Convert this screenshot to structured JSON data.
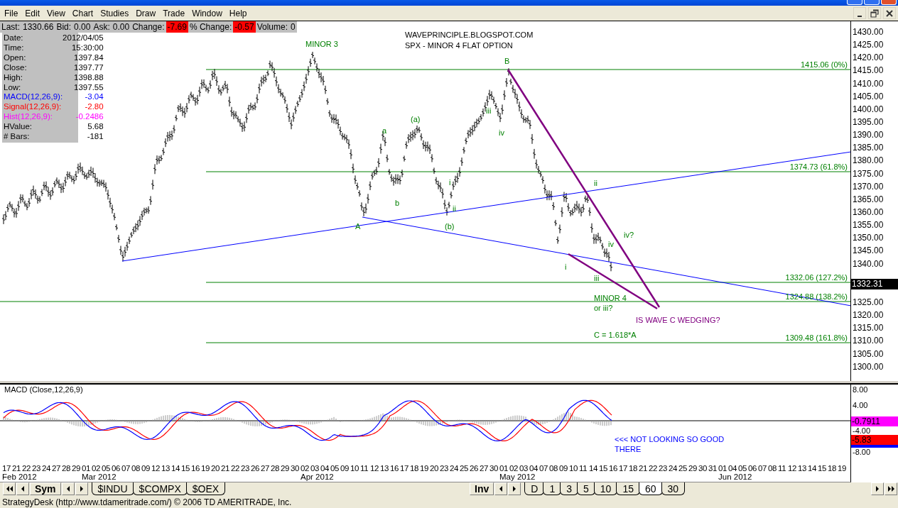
{
  "menu": [
    "File",
    "Edit",
    "View",
    "Chart",
    "Studies",
    "Draw",
    "Trade",
    "Window",
    "Help"
  ],
  "quote_strip": [
    {
      "label": "Last:",
      "value": "1330.66",
      "alert": false
    },
    {
      "label": "Bid:",
      "value": "0.00",
      "alert": false
    },
    {
      "label": "Ask:",
      "value": "0.00",
      "alert": false
    },
    {
      "label": "Change:",
      "value": "-7.69",
      "alert": true
    },
    {
      "label": "% Change:",
      "value": "-0.57",
      "alert": true
    },
    {
      "label": "Volume:",
      "value": "0",
      "alert": false
    }
  ],
  "data_box": [
    {
      "label": "Date:",
      "value": "2012/04/05",
      "color": "#000000"
    },
    {
      "label": "Time:",
      "value": "15:30:00",
      "color": "#000000"
    },
    {
      "label": "Open:",
      "value": "1397.84",
      "color": "#000000"
    },
    {
      "label": "Close:",
      "value": "1397.77",
      "color": "#000000"
    },
    {
      "label": "High:",
      "value": "1398.88",
      "color": "#000000"
    },
    {
      "label": "Low:",
      "value": "1397.55",
      "color": "#000000"
    },
    {
      "label": "MACD(12,26,9):",
      "value": "-3.04",
      "color": "#0000ff"
    },
    {
      "label": "Signal(12,26,9):",
      "value": "-2.80",
      "color": "#ff0000"
    },
    {
      "label": "Hist(12,26,9):",
      "value": "-0.2486",
      "color": "#ff00ff"
    },
    {
      "label": "HValue:",
      "value": "5.68",
      "color": "#000000"
    },
    {
      "label": "# Bars:",
      "value": "-181",
      "color": "#000000"
    }
  ],
  "annotations": [
    {
      "text": "MINOR 3",
      "kind": "wave"
    },
    {
      "text": "WAVEPRINCIPLE.BLOGSPOT.COM",
      "kind": "heading"
    },
    {
      "text": "SPX - MINOR 4 FLAT OPTION",
      "kind": "heading"
    },
    {
      "text": "B",
      "kind": "wave"
    },
    {
      "text": "iii",
      "kind": "wave"
    },
    {
      "text": "iv",
      "kind": "wave"
    },
    {
      "text": "(a)",
      "kind": "wave"
    },
    {
      "text": "a",
      "kind": "wave"
    },
    {
      "text": "b",
      "kind": "wave"
    },
    {
      "text": "i",
      "kind": "wave"
    },
    {
      "text": "ii",
      "kind": "wave"
    },
    {
      "text": "A",
      "kind": "wave"
    },
    {
      "text": "(b)",
      "kind": "wave"
    },
    {
      "text": "ii",
      "kind": "wave"
    },
    {
      "text": "iv?",
      "kind": "wave"
    },
    {
      "text": "iv",
      "kind": "wave"
    },
    {
      "text": "i",
      "kind": "wave"
    },
    {
      "text": "iii",
      "kind": "wave"
    },
    {
      "text": "MINOR 4",
      "kind": "wave"
    },
    {
      "text": "or iii?",
      "kind": "wave"
    },
    {
      "text": "IS WAVE C WEDGING?",
      "kind": "question"
    },
    {
      "text": "C = 1.618*A",
      "kind": "wave"
    }
  ],
  "fib_levels": [
    {
      "label": "1415.06 (0%)"
    },
    {
      "label": "1374.73 (61.8%)"
    },
    {
      "label": "1332.06 (127.2%)"
    },
    {
      "label": "1324.88 (138.2%)"
    },
    {
      "label": "1309.48 (161.8%)"
    }
  ],
  "price_axis": [
    {
      "kind": "tick",
      "text": "1430.00"
    },
    {
      "kind": "tick",
      "text": "1425.00"
    },
    {
      "kind": "tick",
      "text": "1420.00"
    },
    {
      "kind": "tick",
      "text": "1415.00"
    },
    {
      "kind": "tick",
      "text": "1410.00"
    },
    {
      "kind": "tick",
      "text": "1405.00"
    },
    {
      "kind": "tick",
      "text": "1400.00"
    },
    {
      "kind": "tick",
      "text": "1395.00"
    },
    {
      "kind": "tick",
      "text": "1390.00"
    },
    {
      "kind": "tick",
      "text": "1385.00"
    },
    {
      "kind": "tick",
      "text": "1380.00"
    },
    {
      "kind": "tick",
      "text": "1375.00"
    },
    {
      "kind": "tick",
      "text": "1370.00"
    },
    {
      "kind": "tick",
      "text": "1365.00"
    },
    {
      "kind": "tick",
      "text": "1360.00"
    },
    {
      "kind": "tick",
      "text": "1355.00"
    },
    {
      "kind": "tick",
      "text": "1350.00"
    },
    {
      "kind": "tick",
      "text": "1345.00"
    },
    {
      "kind": "tick",
      "text": "1340.00"
    },
    {
      "kind": "current",
      "text": "1332.31"
    },
    {
      "kind": "tick",
      "text": "1325.00"
    },
    {
      "kind": "tick",
      "text": "1320.00"
    },
    {
      "kind": "tick",
      "text": "1315.00"
    },
    {
      "kind": "tick",
      "text": "1310.00"
    },
    {
      "kind": "tick",
      "text": "1305.00"
    },
    {
      "kind": "tick",
      "text": "1300.00"
    }
  ],
  "macd": {
    "title": "MACD (Close,12,26,9)",
    "notes": [
      {
        "text": "<<< NOT LOOKING SO GOOD"
      },
      {
        "text": "THERE"
      }
    ],
    "axis": [
      {
        "kind": "tick",
        "text": "8.00"
      },
      {
        "kind": "tick",
        "text": "4.00"
      },
      {
        "kind": "badge",
        "text": "-0.7911",
        "color": "#ff00ff"
      },
      {
        "kind": "tick",
        "text": "-4.00"
      },
      {
        "kind": "badge",
        "text": "-5.83",
        "color": "#ff0000"
      },
      {
        "kind": "strip",
        "color": "#0000ff"
      },
      {
        "kind": "tick",
        "text": "-8.00"
      }
    ]
  },
  "date_axis": [
    {
      "day": "17",
      "month": "Feb 2012"
    },
    {
      "day": "21"
    },
    {
      "day": "22"
    },
    {
      "day": "23"
    },
    {
      "day": "24"
    },
    {
      "day": "27"
    },
    {
      "day": "28"
    },
    {
      "day": "29"
    },
    {
      "day": "01",
      "month": "Mar 2012"
    },
    {
      "day": "02"
    },
    {
      "day": "05"
    },
    {
      "day": "06"
    },
    {
      "day": "07"
    },
    {
      "day": "08"
    },
    {
      "day": "09"
    },
    {
      "day": "12"
    },
    {
      "day": "13"
    },
    {
      "day": "14"
    },
    {
      "day": "15"
    },
    {
      "day": "16"
    },
    {
      "day": "19"
    },
    {
      "day": "20"
    },
    {
      "day": "21"
    },
    {
      "day": "22"
    },
    {
      "day": "23"
    },
    {
      "day": "26"
    },
    {
      "day": "27"
    },
    {
      "day": "28"
    },
    {
      "day": "29"
    },
    {
      "day": "30"
    },
    {
      "day": "02",
      "month": "Apr 2012"
    },
    {
      "day": "03"
    },
    {
      "day": "04"
    },
    {
      "day": "05"
    },
    {
      "day": "09"
    },
    {
      "day": "10"
    },
    {
      "day": "11"
    },
    {
      "day": "12"
    },
    {
      "day": "13"
    },
    {
      "day": "16"
    },
    {
      "day": "17"
    },
    {
      "day": "18"
    },
    {
      "day": "19"
    },
    {
      "day": "20"
    },
    {
      "day": "23"
    },
    {
      "day": "24"
    },
    {
      "day": "25"
    },
    {
      "day": "26"
    },
    {
      "day": "27"
    },
    {
      "day": "30"
    },
    {
      "day": "01",
      "month": "May 2012"
    },
    {
      "day": "02"
    },
    {
      "day": "03"
    },
    {
      "day": "04"
    },
    {
      "day": "07"
    },
    {
      "day": "08"
    },
    {
      "day": "09"
    },
    {
      "day": "10"
    },
    {
      "day": "11"
    },
    {
      "day": "14"
    },
    {
      "day": "15"
    },
    {
      "day": "16"
    },
    {
      "day": "17"
    },
    {
      "day": "18"
    },
    {
      "day": "21"
    },
    {
      "day": "22"
    },
    {
      "day": "23"
    },
    {
      "day": "24"
    },
    {
      "day": "25"
    },
    {
      "day": "29"
    },
    {
      "day": "30"
    },
    {
      "day": "31"
    },
    {
      "day": "01",
      "month": "Jun 2012"
    },
    {
      "day": "04"
    },
    {
      "day": "05"
    },
    {
      "day": "06"
    },
    {
      "day": "07"
    },
    {
      "day": "08"
    },
    {
      "day": "11"
    },
    {
      "day": "12"
    },
    {
      "day": "13"
    },
    {
      "day": "14"
    },
    {
      "day": "15"
    },
    {
      "day": "18"
    },
    {
      "day": "19"
    }
  ],
  "tab_bar": {
    "symbol_button": "Sym",
    "symbol_tabs": [
      {
        "label": "$INDU",
        "selected": false
      },
      {
        "label": "$COMPX",
        "selected": false
      },
      {
        "label": "$OEX",
        "selected": false
      }
    ],
    "interval_button": "Inv",
    "interval_tabs": [
      {
        "label": "D",
        "selected": false
      },
      {
        "label": "1",
        "selected": false
      },
      {
        "label": "3",
        "selected": false
      },
      {
        "label": "5",
        "selected": false
      },
      {
        "label": "10",
        "selected": false
      },
      {
        "label": "15",
        "selected": false
      },
      {
        "label": "60",
        "selected": true
      },
      {
        "label": "30",
        "selected": false
      }
    ]
  },
  "status_bar": "StrategyDesk (http://www.tdameritrade.com/) © 2006 TD AMERITRADE, Inc."
}
